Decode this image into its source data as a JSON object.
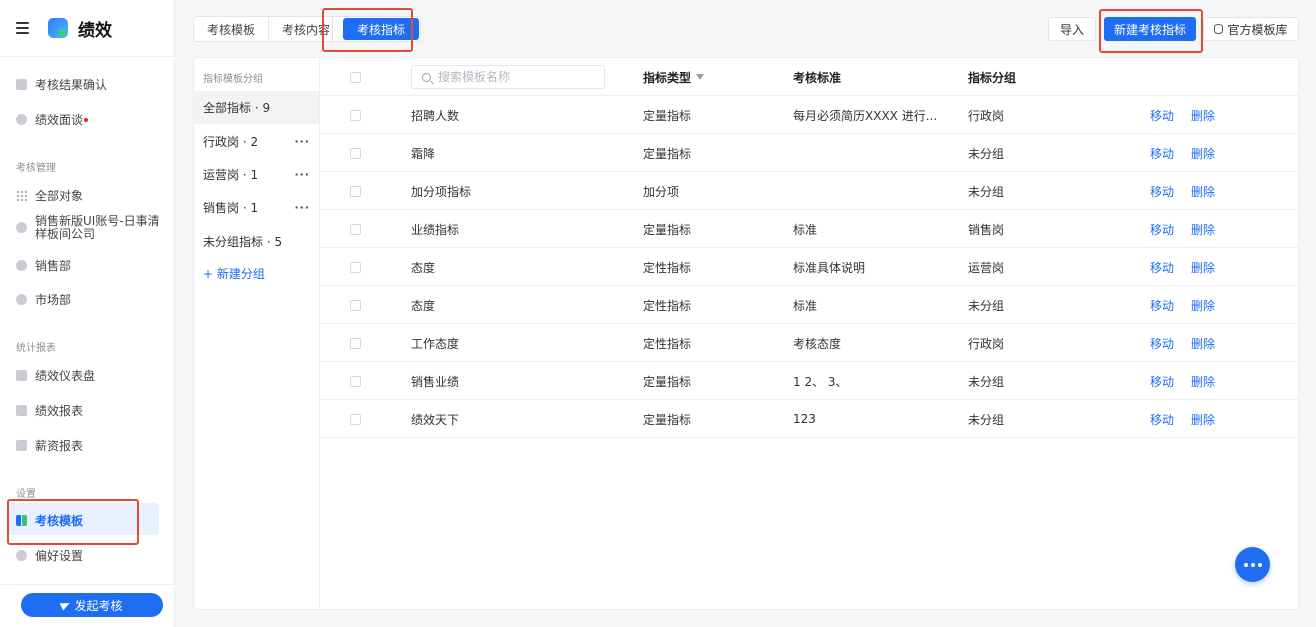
{
  "app": {
    "title": "绩效"
  },
  "sidebar": {
    "top_items": [
      {
        "label": "考核结果确认",
        "icon": "person-upload-icon"
      },
      {
        "label": "绩效面谈",
        "icon": "chat-icon",
        "has_dot": true
      }
    ],
    "section_manage": "考核管理",
    "manage_items": [
      {
        "label": "全部对象",
        "icon": "grid-dots-icon"
      },
      {
        "label": "销售新版UI账号-日事清",
        "label2": "样板间公司",
        "icon": "shield-icon"
      },
      {
        "label": "销售部",
        "icon": "shield-icon"
      },
      {
        "label": "市场部",
        "icon": "shield-icon"
      }
    ],
    "section_reports": "统计报表",
    "report_items": [
      {
        "label": "绩效仪表盘",
        "icon": "monitor-icon"
      },
      {
        "label": "绩效报表",
        "icon": "report-icon"
      },
      {
        "label": "薪资报表",
        "icon": "money-bag-icon"
      }
    ],
    "section_settings": "设置",
    "settings_items": [
      {
        "label": "考核模板",
        "icon": "template-icon",
        "active": true
      },
      {
        "label": "偏好设置",
        "icon": "gear-icon"
      }
    ],
    "launch_button": "发起考核"
  },
  "tabs": [
    {
      "label": "考核模板"
    },
    {
      "label": "考核内容"
    },
    {
      "label": "考核指标",
      "active": true
    }
  ],
  "toolbar": {
    "import_label": "导入",
    "new_label": "新建考核指标",
    "library_label": "官方模板库"
  },
  "groups": {
    "header": "指标模板分组",
    "items": [
      {
        "label": "全部指标 · 9",
        "active": true,
        "more": false
      },
      {
        "label": "行政岗 · 2",
        "more": true
      },
      {
        "label": "运营岗 · 1",
        "more": true
      },
      {
        "label": "销售岗 · 1",
        "more": true
      },
      {
        "label": "未分组指标 · 5",
        "more": false
      }
    ],
    "new_group": "+ 新建分组"
  },
  "table": {
    "search_placeholder": "搜索模板名称",
    "columns": {
      "type": "指标类型",
      "standard": "考核标准",
      "group": "指标分组"
    },
    "action_move": "移动",
    "action_delete": "删除",
    "rows": [
      {
        "name": "招聘人数",
        "type": "定量指标",
        "standard": "每月必须简历XXXX 进行...",
        "group": "行政岗"
      },
      {
        "name": "霜降",
        "type": "定量指标",
        "standard": "",
        "group": "未分组"
      },
      {
        "name": "加分项指标",
        "type": "加分项",
        "standard": "",
        "group": "未分组"
      },
      {
        "name": "业绩指标",
        "type": "定量指标",
        "standard": "标准",
        "group": "销售岗"
      },
      {
        "name": "态度",
        "type": "定性指标",
        "standard": "标准具体说明",
        "group": "运营岗"
      },
      {
        "name": "态度",
        "type": "定性指标",
        "standard": "标准",
        "group": "未分组"
      },
      {
        "name": "工作态度",
        "type": "定性指标",
        "standard": "考核态度",
        "group": "行政岗"
      },
      {
        "name": "销售业绩",
        "type": "定量指标",
        "standard": "1 2、 3、",
        "group": "未分组"
      },
      {
        "name": "绩效天下",
        "type": "定量指标",
        "standard": "123",
        "group": "未分组"
      }
    ]
  },
  "colors": {
    "accent": "#1f6df2",
    "highlight_border": "#e34b36"
  }
}
